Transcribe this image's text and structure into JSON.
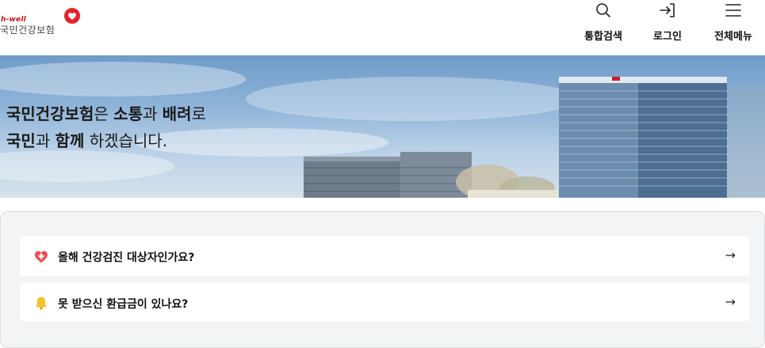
{
  "header": {
    "logo": {
      "brand": "h-well",
      "name": "국민건강보험"
    },
    "nav": [
      {
        "icon": "search-icon",
        "label": "통합검색"
      },
      {
        "icon": "login-icon",
        "label": "로그인"
      },
      {
        "icon": "menu-icon",
        "label": "전체메뉴"
      }
    ]
  },
  "hero": {
    "line1": {
      "b1": "국민건강보험",
      "t1": "은 ",
      "b2": "소통",
      "t2": "과 ",
      "b3": "배려",
      "t3": "로"
    },
    "line2": {
      "b1": "국민",
      "t1": "과 ",
      "b2": "함께",
      "t2": " 하겠습니다."
    }
  },
  "quick_links": [
    {
      "icon": "heart-icon",
      "label": "올해 건강검진 대상자인가요?",
      "arrow": "→"
    },
    {
      "icon": "bell-icon",
      "label": "못 받으신 환급금이 있나요?",
      "arrow": "→"
    }
  ],
  "colors": {
    "brand_red": "#e2252b",
    "card_bg": "#f3f4f6"
  }
}
